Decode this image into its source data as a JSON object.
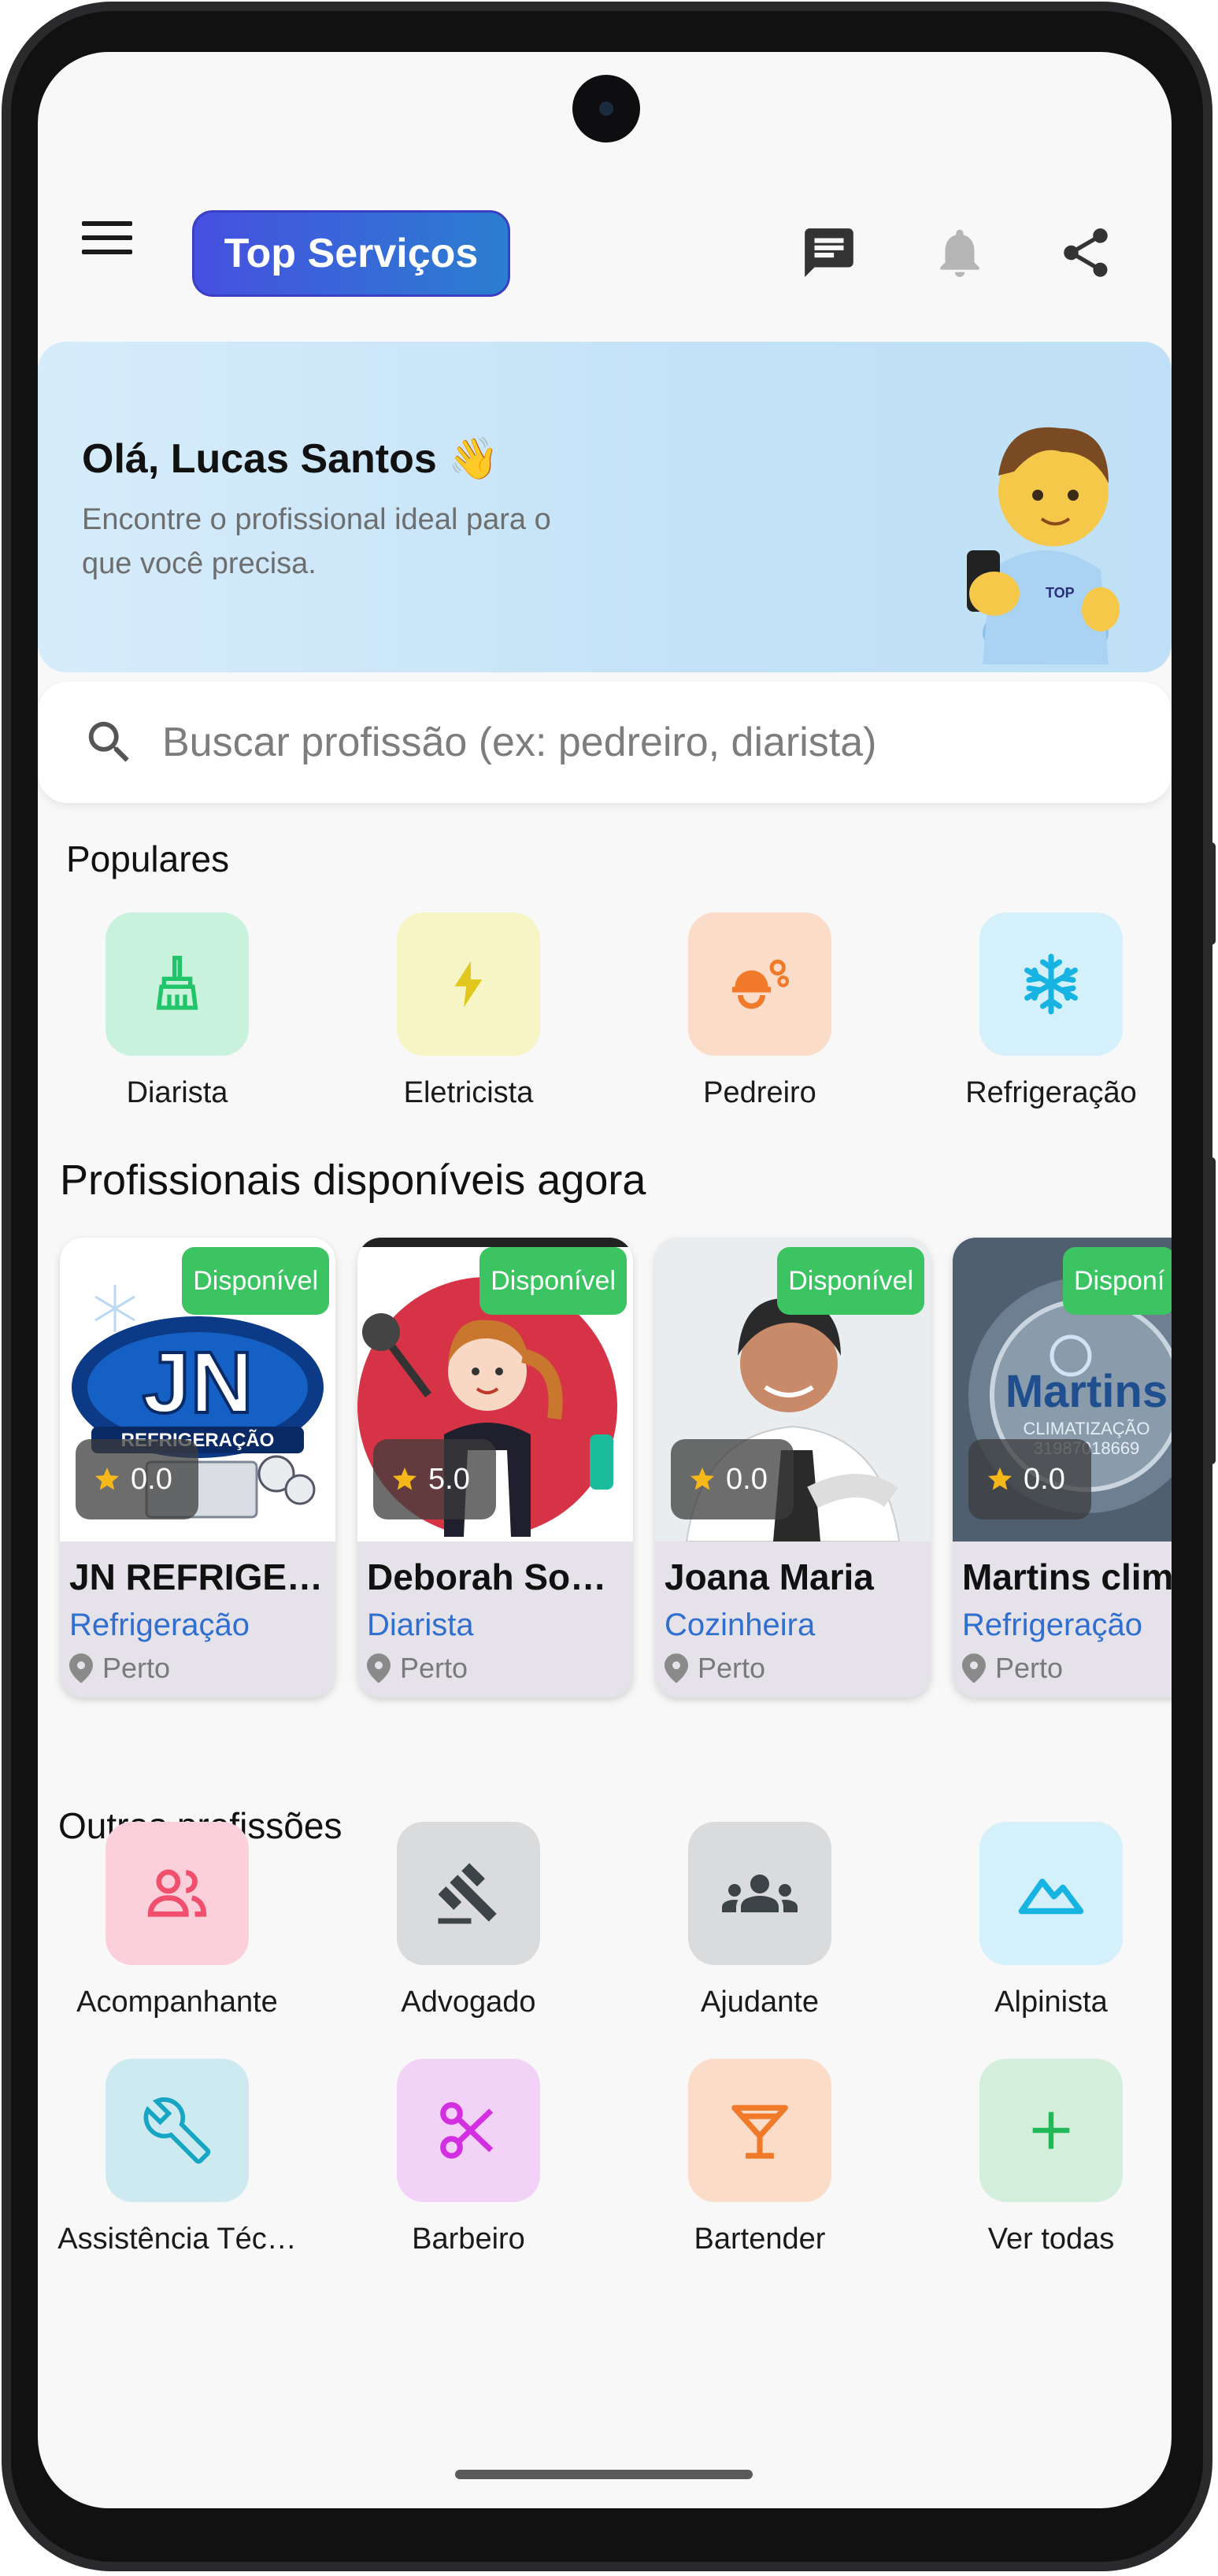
{
  "header": {
    "brand": "Top Serviços",
    "icons": [
      "menu-icon",
      "chat-icon",
      "bell-icon",
      "share-icon"
    ]
  },
  "hero": {
    "greeting": "Olá, Lucas Santos 👋",
    "subtitle": "Encontre o profissional ideal para o que você precisa."
  },
  "search": {
    "placeholder": "Buscar profissão (ex: pedreiro, diarista)"
  },
  "popular": {
    "title": "Populares",
    "items": [
      {
        "label": "Diarista",
        "icon": "broom-icon",
        "bg": "#c9f2dc",
        "fg": "#22c46a"
      },
      {
        "label": "Eletricista",
        "icon": "lightning-icon",
        "bg": "#f7f4c6",
        "fg": "#e2c81e"
      },
      {
        "label": "Pedreiro",
        "icon": "construction-worker-icon",
        "bg": "#fbdcc8",
        "fg": "#f07a2a"
      },
      {
        "label": "Refrigeração",
        "icon": "snowflake-icon",
        "bg": "#d3f0fb",
        "fg": "#16b3e3"
      }
    ]
  },
  "professionals": {
    "title": "Profissionais disponíveis agora",
    "badge": "Disponível",
    "cards": [
      {
        "name": "JN REFRIGE…",
        "profession": "Refrigeração",
        "rating": "0.0",
        "location": "Perto"
      },
      {
        "name": "Deborah Sou…",
        "profession": "Diarista",
        "rating": "5.0",
        "location": "Perto"
      },
      {
        "name": "Joana Maria",
        "profession": "Cozinheira",
        "rating": "0.0",
        "location": "Perto"
      },
      {
        "name": "Martins clim",
        "profession": "Refrigeração",
        "rating": "0.0",
        "location": "Perto",
        "badge": "Disponí"
      }
    ],
    "logos": {
      "jn_main": "JN",
      "jn_sub": "REFRIGERAÇÃO",
      "martins_main": "Martins",
      "martins_sub": "CLIMATIZAÇÃO",
      "martins_phone": "31987018669"
    }
  },
  "others": {
    "title": "Outras profissões",
    "items": [
      {
        "label": "Acompanhante",
        "icon": "people-icon",
        "bg": "#fbd0da",
        "fg": "#f0506e"
      },
      {
        "label": "Advogado",
        "icon": "gavel-icon",
        "bg": "#d9dbdc",
        "fg": "#3d4447"
      },
      {
        "label": "Ajudante",
        "icon": "group-icon",
        "bg": "#d9dbdc",
        "fg": "#3d4447"
      },
      {
        "label": "Alpinista",
        "icon": "mountain-icon",
        "bg": "#d3f0fb",
        "fg": "#16b3e3"
      },
      {
        "label": "Assistência Téc…",
        "icon": "wrench-icon",
        "bg": "#cdeaf0",
        "fg": "#16a6c4"
      },
      {
        "label": "Barbeiro",
        "icon": "scissors-icon",
        "bg": "#f3d2f7",
        "fg": "#d12fe0"
      },
      {
        "label": "Bartender",
        "icon": "cocktail-icon",
        "bg": "#fbdcc8",
        "fg": "#f07a2a"
      },
      {
        "label": "Ver todas",
        "icon": "plus-icon",
        "bg": "#d3efdb",
        "fg": "#22b85a"
      }
    ]
  }
}
